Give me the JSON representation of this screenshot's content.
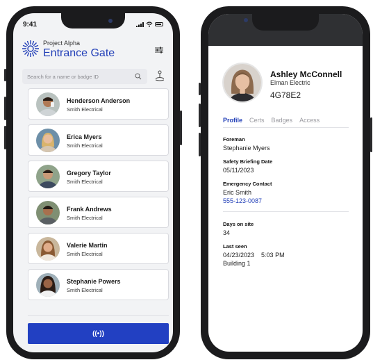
{
  "left_screen": {
    "status_time": "9:41",
    "project_name": "Project Alpha",
    "gate_title": "Entrance Gate",
    "search": {
      "placeholder": "Search for a name or badge ID"
    },
    "workers": [
      {
        "name": "Henderson Anderson",
        "company": "Smith Electrical"
      },
      {
        "name": "Erica Myers",
        "company": "Smith Electrical"
      },
      {
        "name": "Gregory Taylor",
        "company": "Smith Electrical"
      },
      {
        "name": "Frank Andrews",
        "company": "Smith Electrical"
      },
      {
        "name": "Valerie Martin",
        "company": "Smith Electrical"
      },
      {
        "name": "Stephanie Powers",
        "company": "Smith Electrical"
      }
    ],
    "nfc_button_label": "((•))"
  },
  "right_screen": {
    "profile": {
      "name": "Ashley McConnell",
      "company": "Elman Electric",
      "badge_id": "4G78E2"
    },
    "tabs": [
      "Profile",
      "Certs",
      "Badges",
      "Access"
    ],
    "active_tab": "Profile",
    "fields": {
      "foreman_label": "Foreman",
      "foreman_value": "Stephanie Myers",
      "briefing_label": "Safety Briefing Date",
      "briefing_value": "05/11/2023",
      "emergency_label": "Emergency Contact",
      "emergency_name": "Eric Smith",
      "emergency_phone": "555-123-0087",
      "days_label": "Days on site",
      "days_value": "34",
      "last_seen_label": "Last seen",
      "last_seen_datetime": "04/23/2023    5:03 PM",
      "last_seen_location": "Building 1"
    }
  },
  "colors": {
    "accent": "#2340b8",
    "button": "#2240c2",
    "frame": "#1b1b1d"
  },
  "icons": [
    "sunburst-logo-icon",
    "filter-icon",
    "search-icon",
    "badge-scan-icon",
    "nfc-icon",
    "wifi-icon",
    "signal-icon",
    "battery-icon"
  ]
}
